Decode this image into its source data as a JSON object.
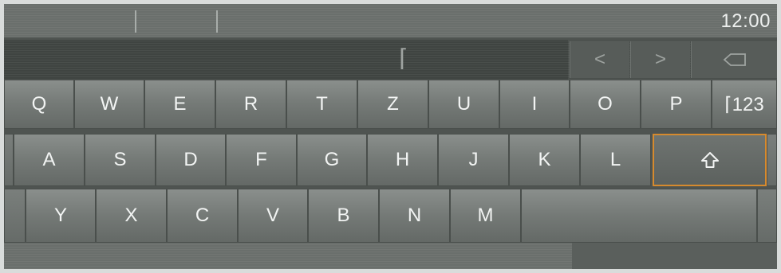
{
  "status": {
    "time": "12:00"
  },
  "input": {
    "cursor_glyph": "⌈",
    "nav": {
      "left_glyph": "<",
      "right_glyph": ">",
      "backspace_icon": "backspace-icon"
    }
  },
  "keyboard": {
    "row1": [
      "Q",
      "W",
      "E",
      "R",
      "T",
      "Z",
      "U",
      "I",
      "O",
      "P"
    ],
    "mode_key_label": "⌈123",
    "row2": [
      "A",
      "S",
      "D",
      "F",
      "G",
      "H",
      "J",
      "K",
      "L"
    ],
    "shift_icon": "shift-arrow-icon",
    "row3": [
      "Y",
      "X",
      "C",
      "V",
      "B",
      "N",
      "M"
    ],
    "space_label": ""
  },
  "colors": {
    "shift_highlight": "#d68a2e",
    "key_text": "#f2f4f3"
  }
}
